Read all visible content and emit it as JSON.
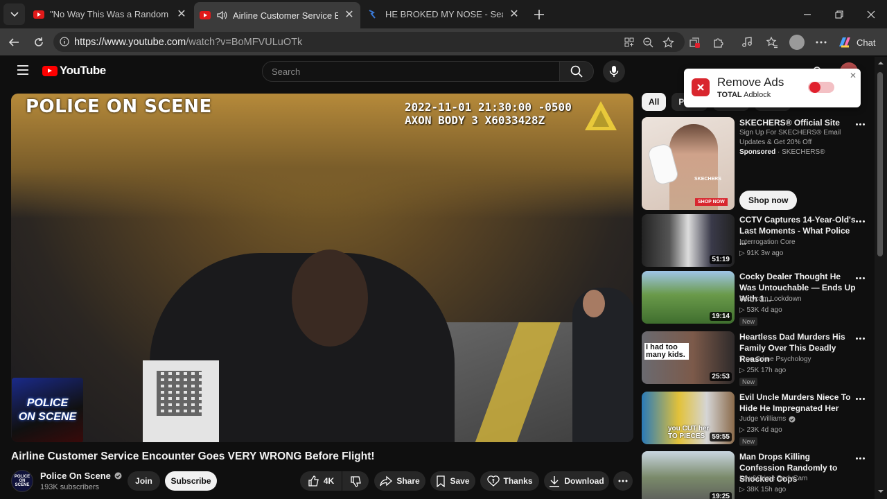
{
  "browser": {
    "tabs": [
      {
        "title": "\"No Way This Was a Random Traffic",
        "active": false
      },
      {
        "title": "Airline Customer Service Encounter",
        "active": true
      },
      {
        "title": "HE BROKED MY NOSE - Search",
        "active": false
      }
    ],
    "url_host": "https://www.youtube.com",
    "url_path": "/watch?v=BoMFVULuOTk",
    "chat_label": "Chat"
  },
  "youtube": {
    "logo_text": "YouTube",
    "search_placeholder": "Search"
  },
  "video": {
    "osd_title": "POLICE ON SCENE",
    "osd_timestamp": "2022-11-01 21:30:00 -0500",
    "osd_device": "AXON BODY 3 X6033428Z",
    "watermark_line1": "POLICE",
    "watermark_line2": "ON SCENE",
    "title": "Airline Customer Service Encounter Goes VERY WRONG Before Flight!",
    "channel_name": "Police On Scene",
    "channel_avatar_text": "POLICE ON SCENE",
    "subscribers": "193K subscribers",
    "actions": {
      "join": "Join",
      "subscribe": "Subscribe",
      "likes": "4K",
      "share": "Share",
      "save": "Save",
      "thanks": "Thanks",
      "download": "Download"
    }
  },
  "chips": [
    {
      "label": "All",
      "active": true
    },
    {
      "label": "Po",
      "active": false
    }
  ],
  "adblock": {
    "title": "Remove Ads",
    "brand_bold": "TOTAL",
    "brand_rest": " Adblock"
  },
  "ad": {
    "title": "SKECHERS® Official Site",
    "description": "Sign Up For SKECHERS® Email Updates & Get 20% Off",
    "sponsored_label": "Sponsored",
    "sponsor": " · SKECHERS®",
    "thumb_brand": "SKECHERS",
    "thumb_shop": "SHOP NOW",
    "cta": "Shop now"
  },
  "recommendations": [
    {
      "title": "CCTV Captures 14-Year-Old's Last Moments - What Police ...",
      "channel": "Interrogation Core",
      "verified": false,
      "stats": "▷ 91K  3w ago",
      "new": "",
      "duration": "51:19",
      "thumb_text": ""
    },
    {
      "title": "Cocky Dealer Thought He Was Untouchable — Ends Up With 1...",
      "channel": "Bodycam Lockdown",
      "verified": false,
      "stats": "▷ 53K  4d ago",
      "new": "New",
      "duration": "19:14",
      "thumb_text": ""
    },
    {
      "title": "Heartless Dad Murders His Family Over This Deadly Reason",
      "channel": "True Crime Psychology",
      "verified": false,
      "stats": "▷ 25K  17h ago",
      "new": "New",
      "duration": "25:53",
      "thumb_text": "I had too many kids."
    },
    {
      "title": "Evil Uncle Murders Niece To Hide He Impregnated Her",
      "channel": "Judge Williams",
      "verified": true,
      "stats": "▷ 23K  4d ago",
      "new": "New",
      "duration": "59:55",
      "thumb_text": "you CUT her TO PIECES"
    },
    {
      "title": "Man Drops Killing Confession Randomly to Shocked Cops",
      "channel": "Law&Crime BodyCam",
      "verified": false,
      "stats": "▷ 38K  15h ago",
      "new": "",
      "duration": "19:25",
      "thumb_text": ""
    }
  ],
  "colors": {
    "yt_red": "#ff0000",
    "background": "#0f0f0f",
    "chip_bg": "#272727",
    "adblock_red": "#d9262e"
  }
}
